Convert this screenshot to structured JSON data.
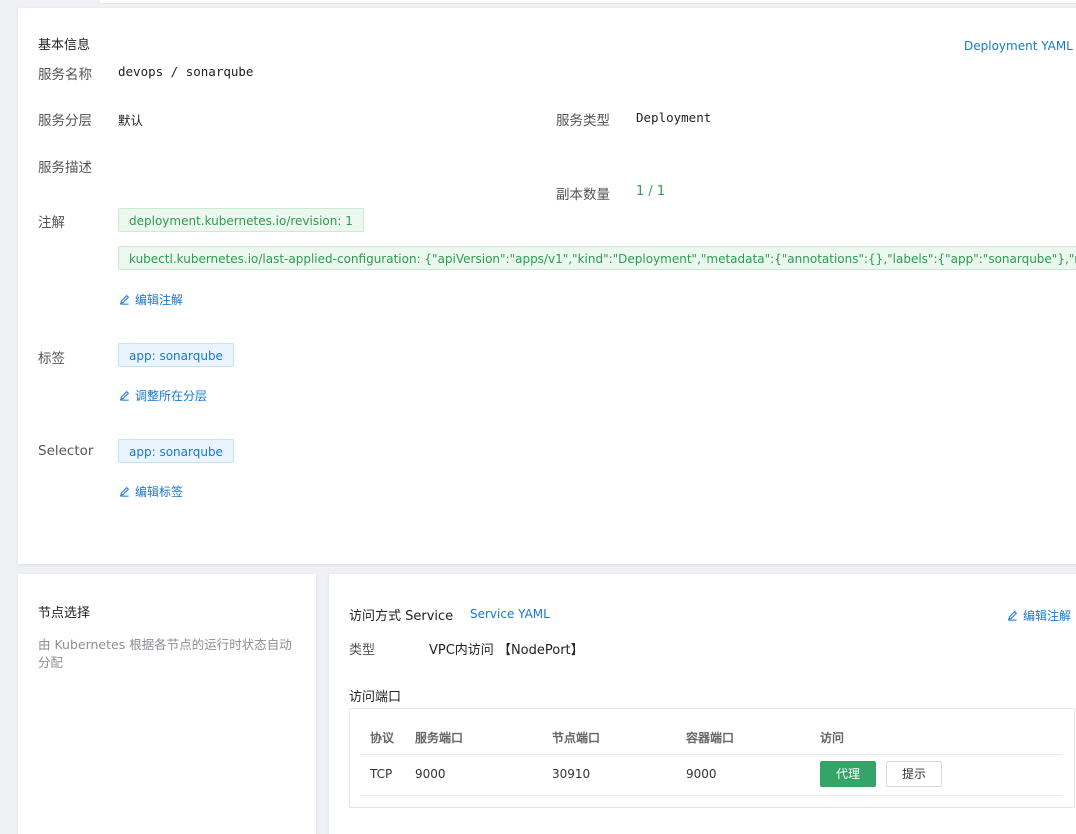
{
  "basic": {
    "title": "基本信息",
    "yaml_link": "Deployment YAML",
    "service_name_label": "服务名称",
    "service_name_value": "devops / sonarqube",
    "layer_label": "服务分层",
    "layer_value": "默认",
    "type_label": "服务类型",
    "type_value": "Deployment",
    "desc_label": "服务描述",
    "replicas_label": "副本数量",
    "replicas_value": "1 / 1",
    "annotations_label": "注解",
    "annotations": [
      "deployment.kubernetes.io/revision: 1",
      "kubectl.kubernetes.io/last-applied-configuration: {\"apiVersion\":\"apps/v1\",\"kind\":\"Deployment\",\"metadata\":{\"annotations\":{},\"labels\":{\"app\":\"sonarqube\"},\"name\":\"sonarqube\",\"namespace\":\"devops\"}}"
    ],
    "edit_annotations": "编辑注解",
    "labels_label": "标签",
    "labels": [
      "app: sonarqube"
    ],
    "adjust_layer": "调整所在分层",
    "selector_label": "Selector",
    "selector": [
      "app: sonarqube"
    ],
    "edit_labels": "编辑标签"
  },
  "node": {
    "title": "节点选择",
    "desc_line1": "由 Kubernetes 根据各节点的运行时状态自动",
    "desc_line2": "分配"
  },
  "service": {
    "title": "访问方式 Service",
    "yaml_link": "Service YAML",
    "edit_annotations": "编辑注解",
    "type_label": "类型",
    "type_value": "VPC内访问 【NodePort】",
    "ports_title": "访问端口",
    "columns": [
      "协议",
      "服务端口",
      "节点端口",
      "容器端口",
      "访问"
    ],
    "rows": [
      {
        "protocol": "TCP",
        "service_port": "9000",
        "node_port": "30910",
        "container_port": "9000",
        "proxy_label": "代理",
        "hint_label": "提示"
      }
    ]
  },
  "colors": {
    "accent_blue": "#1678d3",
    "accent_green": "#34a567"
  }
}
